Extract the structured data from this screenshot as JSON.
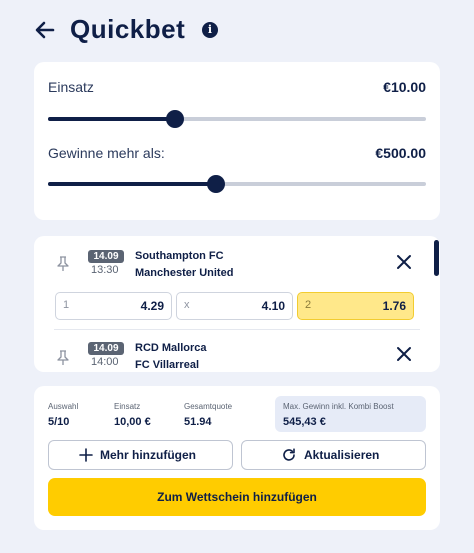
{
  "header": {
    "title": "Quickbet"
  },
  "stake": {
    "einsatz_label": "Einsatz",
    "einsatz_value": "€10.00",
    "einsatz_slider_fraction": 0.335,
    "gewinne_label": "Gewinne mehr als:",
    "gewinne_value": "€500.00",
    "gewinne_slider_fraction": 0.445
  },
  "matches": [
    {
      "date": "14.09",
      "time": "13:30",
      "home": "Southampton FC",
      "away": "Manchester United",
      "odds": [
        {
          "label": "1",
          "value": "4.29",
          "selected": false
        },
        {
          "label": "x",
          "value": "4.10",
          "selected": false
        },
        {
          "label": "2",
          "value": "1.76",
          "selected": true
        }
      ]
    },
    {
      "date": "14.09",
      "time": "14:00",
      "home": "RCD Mallorca",
      "away": "FC Villarreal"
    }
  ],
  "summary": {
    "auswahl_label": "Auswahl",
    "auswahl_value": "5/10",
    "einsatz_label": "Einsatz",
    "einsatz_value": "10,00 €",
    "gesamtquote_label": "Gesamtquote",
    "gesamtquote_value": "51.94",
    "max_gewinn_label": "Max. Gewinn inkl. Kombi Boost",
    "max_gewinn_value": "545,43 €"
  },
  "buttons": {
    "add_more": "Mehr hinzufügen",
    "refresh": "Aktualisieren",
    "add_to_slip": "Zum Wettschein hinzufügen"
  },
  "colors": {
    "navy": "#0f1f47",
    "accent_yellow": "#ffcc00",
    "selected_odd": "#ffe88a",
    "background": "#eef1f9"
  }
}
